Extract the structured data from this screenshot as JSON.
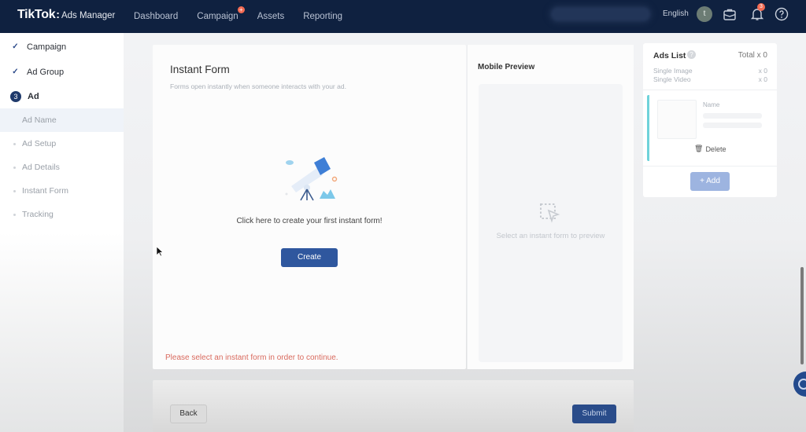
{
  "header": {
    "brand": "TikTok",
    "product": "Ads Manager",
    "nav": [
      {
        "label": "Dashboard",
        "badge": null
      },
      {
        "label": "Campaign",
        "badge": "+"
      },
      {
        "label": "Assets",
        "badge": null
      },
      {
        "label": "Reporting",
        "badge": null
      }
    ],
    "language": "English",
    "avatar_initial": "t",
    "notification_count": "3",
    "icons": [
      "briefcase-icon",
      "bell-icon",
      "help-circle-icon"
    ]
  },
  "sidebar": {
    "steps": [
      {
        "label": "Campaign",
        "state": "done"
      },
      {
        "label": "Ad Group",
        "state": "done"
      },
      {
        "label": "Ad",
        "state": "current",
        "number": "3"
      }
    ],
    "substeps": [
      {
        "label": "Ad Name",
        "active": true
      },
      {
        "label": "Ad Setup",
        "active": false
      },
      {
        "label": "Ad Details",
        "active": false
      },
      {
        "label": "Instant Form",
        "active": false
      },
      {
        "label": "Tracking",
        "active": false
      }
    ]
  },
  "instant_form": {
    "title": "Instant Form",
    "subtitle": "Forms open instantly when someone interacts with your ad.",
    "prompt": "Click here to create your first instant form!",
    "create_label": "Create",
    "error": "Please select an instant form in order to continue."
  },
  "preview": {
    "title": "Mobile Preview",
    "empty_text": "Select an instant form to preview"
  },
  "ads_list": {
    "title": "Ads List",
    "total": "Total x 0",
    "rows": [
      {
        "label": "Single Image",
        "count": "x 0"
      },
      {
        "label": "Single Video",
        "count": "x 0"
      }
    ],
    "item": {
      "name_label": "Name",
      "delete_label": "Delete"
    },
    "add_label": "+ Add"
  },
  "footer": {
    "back_label": "Back",
    "submit_label": "Submit"
  },
  "colors": {
    "header_bg": "#0f2140",
    "primary": "#2f579e",
    "error": "#d96a5e",
    "badge": "#f36b53",
    "accent_bar": "#6fd3da"
  }
}
